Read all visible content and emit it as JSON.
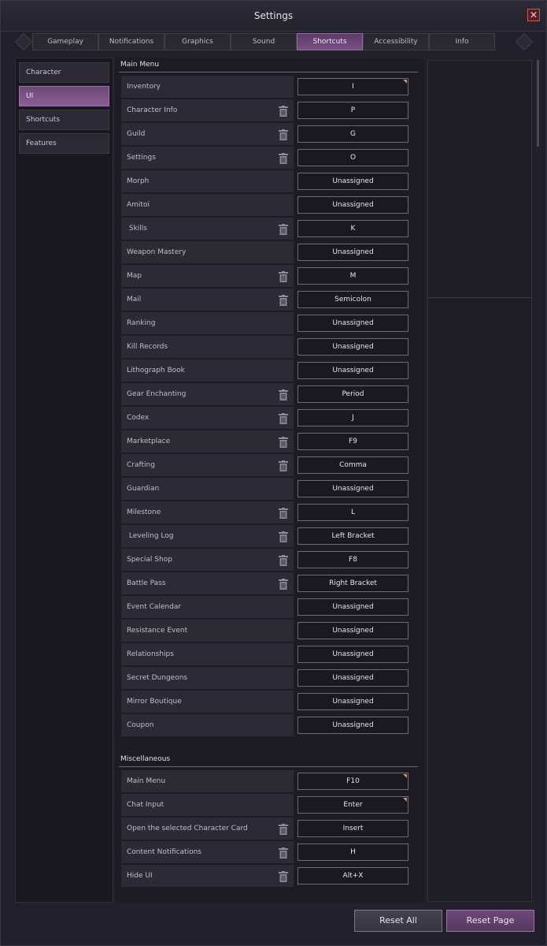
{
  "window": {
    "title": "Settings",
    "close_icon": "✕"
  },
  "tabs": [
    "Gameplay",
    "Notifications",
    "Graphics",
    "Sound",
    "Shortcuts",
    "Accessibility",
    "Info"
  ],
  "active_tab": "Shortcuts",
  "categories": [
    "Character",
    "UI",
    "Shortcuts",
    "Features"
  ],
  "active_category": "UI",
  "main_menu": {
    "title": "Main Menu",
    "rows": [
      {
        "label": "Inventory",
        "key": "I",
        "delete": false,
        "corner": true
      },
      {
        "label": "Character Info",
        "key": "P",
        "delete": true
      },
      {
        "label": "Guild",
        "key": "G",
        "delete": true
      },
      {
        "label": "Settings",
        "key": "O",
        "delete": true
      },
      {
        "label": "Morph",
        "key": "Unassigned",
        "delete": false
      },
      {
        "label": "Amitoi",
        "key": "Unassigned",
        "delete": false
      },
      {
        "label": " Skills",
        "key": "K",
        "delete": true
      },
      {
        "label": "Weapon Mastery",
        "key": "Unassigned",
        "delete": false
      },
      {
        "label": "Map",
        "key": "M",
        "delete": true
      },
      {
        "label": "Mail",
        "key": "Semicolon",
        "delete": true
      },
      {
        "label": "Ranking",
        "key": "Unassigned",
        "delete": false
      },
      {
        "label": "Kill Records",
        "key": "Unassigned",
        "delete": false
      },
      {
        "label": "Lithograph Book",
        "key": "Unassigned",
        "delete": false
      },
      {
        "label": "Gear Enchanting",
        "key": "Period",
        "delete": true
      },
      {
        "label": "Codex",
        "key": "J",
        "delete": true
      },
      {
        "label": "Marketplace",
        "key": "F9",
        "delete": true
      },
      {
        "label": "Crafting",
        "key": "Comma",
        "delete": true
      },
      {
        "label": "Guardian",
        "key": "Unassigned",
        "delete": false
      },
      {
        "label": "Milestone",
        "key": "L",
        "delete": true
      },
      {
        "label": " Leveling Log",
        "key": "Left Bracket",
        "delete": true
      },
      {
        "label": "Special Shop",
        "key": "F8",
        "delete": true
      },
      {
        "label": "Battle Pass",
        "key": "Right Bracket",
        "delete": true
      },
      {
        "label": "Event Calendar",
        "key": "Unassigned",
        "delete": false
      },
      {
        "label": "Resistance Event",
        "key": "Unassigned",
        "delete": false
      },
      {
        "label": "Relationships",
        "key": "Unassigned",
        "delete": false
      },
      {
        "label": "Secret Dungeons",
        "key": "Unassigned",
        "delete": false
      },
      {
        "label": "Mirror Boutique",
        "key": "Unassigned",
        "delete": false
      },
      {
        "label": "Coupon",
        "key": "Unassigned",
        "delete": false
      }
    ]
  },
  "misc": {
    "title": "Miscellaneous",
    "rows": [
      {
        "label": "Main Menu",
        "key": "F10",
        "delete": false,
        "corner": true
      },
      {
        "label": "Chat Input",
        "key": "Enter",
        "delete": false,
        "corner": true
      },
      {
        "label": "Open the selected Character Card",
        "key": "Insert",
        "delete": true
      },
      {
        "label": "Content Notifications",
        "key": "H",
        "delete": true
      },
      {
        "label": "Hide UI",
        "key": "Alt+X",
        "delete": true
      }
    ]
  },
  "buttons": {
    "reset_all": "Reset All",
    "reset_page": "Reset Page"
  },
  "colors": {
    "accent": "#7a4f86",
    "panel": "#2c2b35",
    "background": "#22212b"
  },
  "icons": {
    "delete": "trash-icon",
    "close": "close-icon"
  }
}
